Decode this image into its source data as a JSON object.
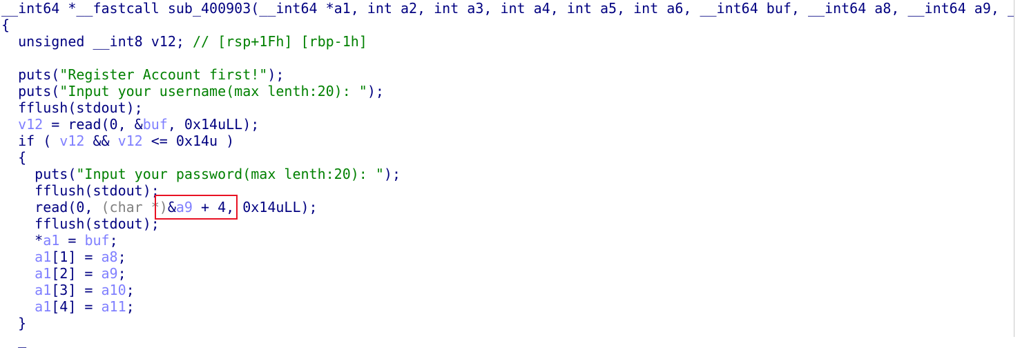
{
  "code_view": {
    "highlight_color": "#e81123",
    "colors": {
      "plain": "#000080",
      "variable": "#7f7fff",
      "string": "#008000",
      "comment": "#008000",
      "type_cast": "#808080"
    },
    "lines": [
      [
        [
          "plain",
          "__int64 *__fastcall sub_400903(__int64 *a1, int a2, int a3, int a4, int a5, int a6, __int64 buf, __int64 a8, __int64 a9, _"
        ]
      ],
      [
        [
          "plain",
          "{"
        ]
      ],
      [
        [
          "plain",
          "  unsigned __int8 v12; "
        ],
        [
          "cmt",
          "// [rsp+1Fh] [rbp-1h]"
        ]
      ],
      [
        [
          "plain",
          ""
        ]
      ],
      [
        [
          "plain",
          "  puts("
        ],
        [
          "str",
          "\"Register Account first!\""
        ],
        [
          "plain",
          ");"
        ]
      ],
      [
        [
          "plain",
          "  puts("
        ],
        [
          "str",
          "\"Input your username(max lenth:20): \""
        ],
        [
          "plain",
          ");"
        ]
      ],
      [
        [
          "plain",
          "  fflush(stdout);"
        ]
      ],
      [
        [
          "plain",
          "  "
        ],
        [
          "var",
          "v12"
        ],
        [
          "plain",
          " = read(0, &"
        ],
        [
          "var",
          "buf"
        ],
        [
          "plain",
          ", 0x14uLL);"
        ]
      ],
      [
        [
          "plain",
          "  if ( "
        ],
        [
          "var",
          "v12"
        ],
        [
          "plain",
          " && "
        ],
        [
          "var",
          "v12"
        ],
        [
          "plain",
          " <= 0x14u )"
        ]
      ],
      [
        [
          "plain",
          "  {"
        ]
      ],
      [
        [
          "plain",
          "    puts("
        ],
        [
          "str",
          "\"Input your password(max lenth:20): \""
        ],
        [
          "plain",
          ");"
        ]
      ],
      [
        [
          "plain",
          "    fflush(stdout);"
        ]
      ],
      [
        [
          "plain",
          "    read(0, "
        ],
        [
          "gray",
          "(char *)"
        ],
        [
          "plain",
          "&"
        ],
        [
          "var",
          "a9"
        ],
        [
          "plain",
          " + 4, 0x14uLL);"
        ]
      ],
      [
        [
          "plain",
          "    fflush(stdout);"
        ]
      ],
      [
        [
          "plain",
          "    *"
        ],
        [
          "var",
          "a1"
        ],
        [
          "plain",
          " = "
        ],
        [
          "var",
          "buf"
        ],
        [
          "plain",
          ";"
        ]
      ],
      [
        [
          "plain",
          "    "
        ],
        [
          "var",
          "a1"
        ],
        [
          "plain",
          "[1] = "
        ],
        [
          "var",
          "a8"
        ],
        [
          "plain",
          ";"
        ]
      ],
      [
        [
          "plain",
          "    "
        ],
        [
          "var",
          "a1"
        ],
        [
          "plain",
          "[2] = "
        ],
        [
          "var",
          "a9"
        ],
        [
          "plain",
          ";"
        ]
      ],
      [
        [
          "plain",
          "    "
        ],
        [
          "var",
          "a1"
        ],
        [
          "plain",
          "[3] = "
        ],
        [
          "var",
          "a10"
        ],
        [
          "plain",
          ";"
        ]
      ],
      [
        [
          "plain",
          "    "
        ],
        [
          "var",
          "a1"
        ],
        [
          "plain",
          "[4] = "
        ],
        [
          "var",
          "a11"
        ],
        [
          "plain",
          ";"
        ]
      ],
      [
        [
          "plain",
          "  }"
        ]
      ],
      [
        [
          "plain",
          "  _"
        ]
      ]
    ]
  }
}
